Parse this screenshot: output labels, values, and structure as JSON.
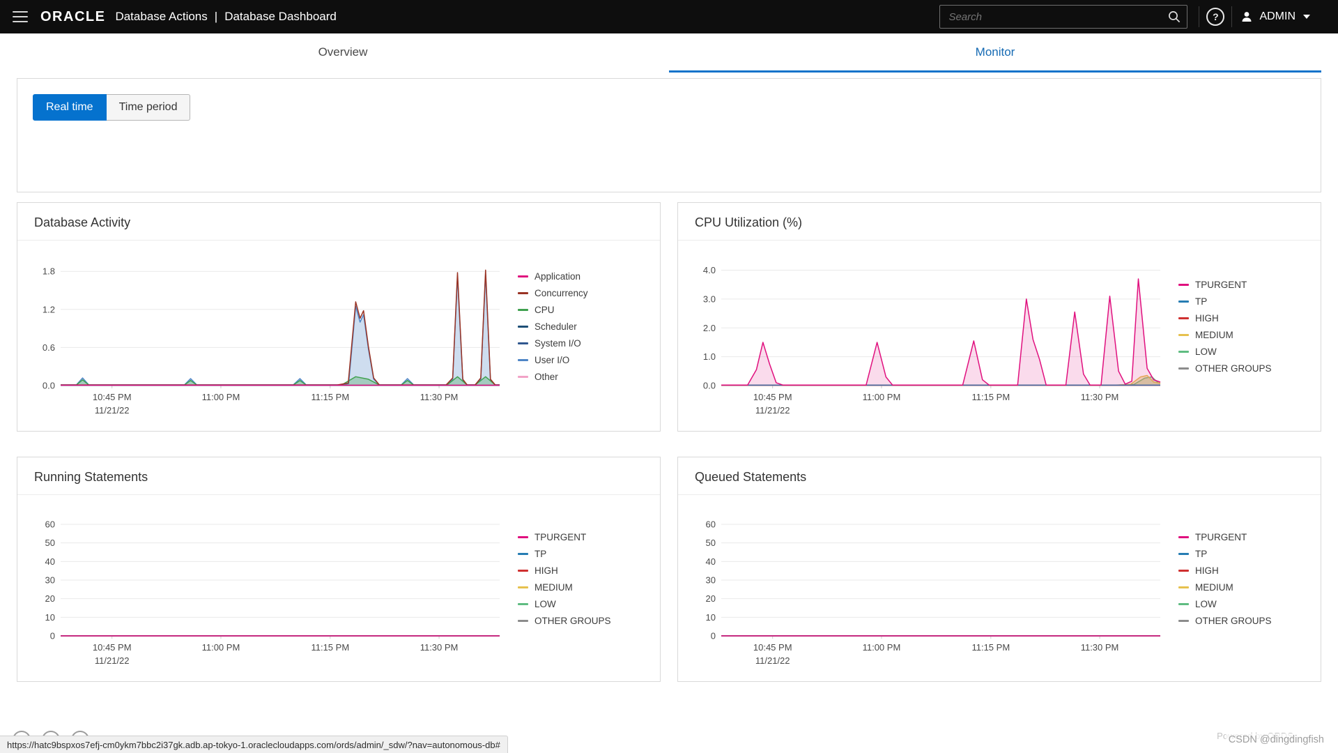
{
  "colors": {
    "accent": "#0572ce",
    "header_bg": "#0e0e0e"
  },
  "header": {
    "brand": "ORACLE",
    "app_title": "Database Actions",
    "divider": "|",
    "page_title": "Database Dashboard",
    "search_placeholder": "Search",
    "user_label": "ADMIN"
  },
  "tabs": {
    "overview": "Overview",
    "monitor": "Monitor"
  },
  "toolbar": {
    "real_time": "Real time",
    "time_period": "Time period"
  },
  "footer": {
    "status_url": "https://hatc9bspxos7efj-cm0ykm7bbc2i37gk.adb.ap-tokyo-1.oraclecloudapps.com/ords/admin/_sdw/?nav=autonomous-db#",
    "watermark": "CSDN @dingdingfish",
    "powered_by": "Powered by ORDS"
  },
  "chart_data": [
    {
      "id": "database-activity",
      "type": "area",
      "title": "Database Activity",
      "ylabel": "",
      "ymax": 2.0,
      "yticks": [
        {
          "v": 0,
          "label": "0.0"
        },
        {
          "v": 0.6,
          "label": "0.6"
        },
        {
          "v": 1.2,
          "label": "1.2"
        },
        {
          "v": 1.8,
          "label": "1.8"
        }
      ],
      "xticks": [
        {
          "pos": 0.117,
          "label": "10:45 PM",
          "sub": "11/21/22"
        },
        {
          "pos": 0.365,
          "label": "11:00 PM"
        },
        {
          "pos": 0.614,
          "label": "11:15 PM"
        },
        {
          "pos": 0.862,
          "label": "11:30 PM"
        }
      ],
      "legend_position": "right",
      "series": [
        {
          "name": "Application",
          "color": "#e0107e",
          "fill": false,
          "fill_opacity": 0,
          "points": [
            [
              0,
              0.005
            ],
            [
              1,
              0.005
            ]
          ]
        },
        {
          "name": "Concurrency",
          "color": "#9a3324",
          "fill": false,
          "fill_opacity": 0,
          "points": [
            [
              0,
              0.01
            ],
            [
              0.63,
              0.01
            ],
            [
              0.655,
              0.04
            ],
            [
              0.672,
              1.32
            ],
            [
              0.682,
              1.06
            ],
            [
              0.69,
              1.18
            ],
            [
              0.701,
              0.62
            ],
            [
              0.713,
              0.12
            ],
            [
              0.726,
              0.01
            ],
            [
              0.878,
              0.01
            ],
            [
              0.893,
              0.12
            ],
            [
              0.904,
              1.78
            ],
            [
              0.916,
              0.1
            ],
            [
              0.926,
              0.01
            ],
            [
              0.944,
              0.01
            ],
            [
              0.957,
              0.12
            ],
            [
              0.968,
              1.82
            ],
            [
              0.979,
              0.1
            ],
            [
              0.99,
              0.01
            ],
            [
              1,
              0.01
            ]
          ]
        },
        {
          "name": "CPU",
          "color": "#3fa14f",
          "fill": true,
          "fill_opacity": 0.3,
          "points": [
            [
              0,
              0.01
            ],
            [
              0.036,
              0.01
            ],
            [
              0.05,
              0.09
            ],
            [
              0.064,
              0.01
            ],
            [
              0.282,
              0.01
            ],
            [
              0.296,
              0.08
            ],
            [
              0.31,
              0.01
            ],
            [
              0.53,
              0.01
            ],
            [
              0.545,
              0.08
            ],
            [
              0.559,
              0.01
            ],
            [
              0.64,
              0.01
            ],
            [
              0.672,
              0.14
            ],
            [
              0.701,
              0.1
            ],
            [
              0.726,
              0.01
            ],
            [
              0.776,
              0.01
            ],
            [
              0.79,
              0.08
            ],
            [
              0.804,
              0.01
            ],
            [
              0.88,
              0.01
            ],
            [
              0.904,
              0.14
            ],
            [
              0.926,
              0.01
            ],
            [
              0.944,
              0.01
            ],
            [
              0.968,
              0.14
            ],
            [
              0.99,
              0.01
            ],
            [
              1,
              0.01
            ]
          ]
        },
        {
          "name": "Scheduler",
          "color": "#1d4f76",
          "fill": false,
          "fill_opacity": 0,
          "points": [
            [
              0,
              0.003
            ],
            [
              1,
              0.003
            ]
          ]
        },
        {
          "name": "System I/O",
          "color": "#30588f",
          "fill": false,
          "fill_opacity": 0,
          "points": [
            [
              0,
              0.004
            ],
            [
              1,
              0.004
            ]
          ]
        },
        {
          "name": "User I/O",
          "color": "#4f86c6",
          "fill": true,
          "fill_opacity": 0.28,
          "points": [
            [
              0,
              0.012
            ],
            [
              0.036,
              0.012
            ],
            [
              0.05,
              0.12
            ],
            [
              0.064,
              0.012
            ],
            [
              0.282,
              0.012
            ],
            [
              0.296,
              0.11
            ],
            [
              0.31,
              0.012
            ],
            [
              0.53,
              0.012
            ],
            [
              0.545,
              0.11
            ],
            [
              0.559,
              0.012
            ],
            [
              0.64,
              0.012
            ],
            [
              0.656,
              0.03
            ],
            [
              0.672,
              1.25
            ],
            [
              0.682,
              1.0
            ],
            [
              0.69,
              1.12
            ],
            [
              0.701,
              0.58
            ],
            [
              0.713,
              0.1
            ],
            [
              0.726,
              0.012
            ],
            [
              0.776,
              0.012
            ],
            [
              0.79,
              0.11
            ],
            [
              0.804,
              0.012
            ],
            [
              0.878,
              0.012
            ],
            [
              0.893,
              0.1
            ],
            [
              0.904,
              1.72
            ],
            [
              0.916,
              0.08
            ],
            [
              0.926,
              0.012
            ],
            [
              0.944,
              0.012
            ],
            [
              0.957,
              0.1
            ],
            [
              0.968,
              1.76
            ],
            [
              0.979,
              0.08
            ],
            [
              0.99,
              0.012
            ],
            [
              1,
              0.012
            ]
          ]
        },
        {
          "name": "Other",
          "color": "#f2a3c7",
          "fill": false,
          "fill_opacity": 0,
          "points": [
            [
              0,
              0.002
            ],
            [
              1,
              0.002
            ]
          ]
        }
      ]
    },
    {
      "id": "cpu-utilization",
      "type": "area",
      "title": "CPU Utilization (%)",
      "ylabel": "",
      "ymax": 4.4,
      "yticks": [
        {
          "v": 0,
          "label": "0.0"
        },
        {
          "v": 1,
          "label": "1.0"
        },
        {
          "v": 2,
          "label": "2.0"
        },
        {
          "v": 3,
          "label": "3.0"
        },
        {
          "v": 4,
          "label": "4.0"
        }
      ],
      "xticks": [
        {
          "pos": 0.117,
          "label": "10:45 PM",
          "sub": "11/21/22"
        },
        {
          "pos": 0.365,
          "label": "11:00 PM"
        },
        {
          "pos": 0.614,
          "label": "11:15 PM"
        },
        {
          "pos": 0.862,
          "label": "11:30 PM"
        }
      ],
      "legend_position": "right",
      "series": [
        {
          "name": "TPURGENT",
          "color": "#e0107e",
          "fill": true,
          "fill_opacity": 0.15,
          "points": [
            [
              0,
              0.02
            ],
            [
              0.06,
              0.02
            ],
            [
              0.08,
              0.55
            ],
            [
              0.095,
              1.5
            ],
            [
              0.11,
              0.75
            ],
            [
              0.125,
              0.1
            ],
            [
              0.14,
              0.02
            ],
            [
              0.33,
              0.02
            ],
            [
              0.355,
              1.5
            ],
            [
              0.375,
              0.3
            ],
            [
              0.39,
              0.02
            ],
            [
              0.55,
              0.02
            ],
            [
              0.575,
              1.55
            ],
            [
              0.595,
              0.2
            ],
            [
              0.61,
              0.02
            ],
            [
              0.675,
              0.02
            ],
            [
              0.695,
              3.0
            ],
            [
              0.71,
              1.6
            ],
            [
              0.725,
              0.9
            ],
            [
              0.74,
              0.02
            ],
            [
              0.785,
              0.02
            ],
            [
              0.805,
              2.55
            ],
            [
              0.825,
              0.4
            ],
            [
              0.84,
              0.02
            ],
            [
              0.865,
              0.02
            ],
            [
              0.885,
              3.1
            ],
            [
              0.905,
              0.5
            ],
            [
              0.92,
              0.05
            ],
            [
              0.935,
              0.15
            ],
            [
              0.95,
              3.7
            ],
            [
              0.97,
              0.6
            ],
            [
              0.985,
              0.2
            ],
            [
              1,
              0.12
            ]
          ]
        },
        {
          "name": "TP",
          "color": "#267db3",
          "fill": false,
          "fill_opacity": 0,
          "points": [
            [
              0,
              0.015
            ],
            [
              1,
              0.015
            ]
          ]
        },
        {
          "name": "HIGH",
          "color": "#cf3030",
          "fill": false,
          "fill_opacity": 0,
          "points": [
            [
              0,
              0.01
            ],
            [
              1,
              0.01
            ]
          ]
        },
        {
          "name": "MEDIUM",
          "color": "#e6c14e",
          "fill": true,
          "fill_opacity": 0.35,
          "points": [
            [
              0,
              0.02
            ],
            [
              0.9,
              0.02
            ],
            [
              0.932,
              0.04
            ],
            [
              0.955,
              0.3
            ],
            [
              0.97,
              0.35
            ],
            [
              0.985,
              0.12
            ],
            [
              1,
              0.08
            ]
          ]
        },
        {
          "name": "LOW",
          "color": "#5fbc81",
          "fill": true,
          "fill_opacity": 0.3,
          "points": [
            [
              0,
              0.015
            ],
            [
              0.9,
              0.015
            ],
            [
              0.94,
              0.04
            ],
            [
              0.965,
              0.26
            ],
            [
              0.981,
              0.3
            ],
            [
              0.995,
              0.1
            ],
            [
              1,
              0.08
            ]
          ]
        },
        {
          "name": "OTHER GROUPS",
          "color": "#8c8c8c",
          "fill": false,
          "fill_opacity": 0,
          "points": [
            [
              0,
              0.005
            ],
            [
              1,
              0.005
            ]
          ]
        }
      ]
    },
    {
      "id": "running-statements",
      "type": "line",
      "title": "Running Statements",
      "ylabel": "",
      "ymax": 66,
      "yticks": [
        {
          "v": 0,
          "label": "0"
        },
        {
          "v": 10,
          "label": "10"
        },
        {
          "v": 20,
          "label": "20"
        },
        {
          "v": 30,
          "label": "30"
        },
        {
          "v": 40,
          "label": "40"
        },
        {
          "v": 50,
          "label": "50"
        },
        {
          "v": 60,
          "label": "60"
        }
      ],
      "xticks": [
        {
          "pos": 0.117,
          "label": "10:45 PM",
          "sub": "11/21/22"
        },
        {
          "pos": 0.365,
          "label": "11:00 PM"
        },
        {
          "pos": 0.614,
          "label": "11:15 PM"
        },
        {
          "pos": 0.862,
          "label": "11:30 PM"
        }
      ],
      "legend_position": "right",
      "series": [
        {
          "name": "TPURGENT",
          "color": "#e0107e",
          "fill": false,
          "fill_opacity": 0,
          "points": [
            [
              0,
              0
            ],
            [
              1,
              0
            ]
          ]
        },
        {
          "name": "TP",
          "color": "#267db3",
          "fill": false,
          "fill_opacity": 0,
          "points": [
            [
              0,
              0
            ],
            [
              1,
              0
            ]
          ]
        },
        {
          "name": "HIGH",
          "color": "#cf3030",
          "fill": false,
          "fill_opacity": 0,
          "points": [
            [
              0,
              0
            ],
            [
              1,
              0
            ]
          ]
        },
        {
          "name": "MEDIUM",
          "color": "#e6c14e",
          "fill": false,
          "fill_opacity": 0,
          "points": [
            [
              0,
              0
            ],
            [
              1,
              0
            ]
          ]
        },
        {
          "name": "LOW",
          "color": "#5fbc81",
          "fill": false,
          "fill_opacity": 0,
          "points": [
            [
              0,
              0
            ],
            [
              1,
              0
            ]
          ]
        },
        {
          "name": "OTHER GROUPS",
          "color": "#8c8c8c",
          "fill": false,
          "fill_opacity": 0,
          "points": [
            [
              0,
              0
            ],
            [
              1,
              0
            ]
          ]
        }
      ]
    },
    {
      "id": "queued-statements",
      "type": "line",
      "title": "Queued Statements",
      "ylabel": "",
      "ymax": 66,
      "yticks": [
        {
          "v": 0,
          "label": "0"
        },
        {
          "v": 10,
          "label": "10"
        },
        {
          "v": 20,
          "label": "20"
        },
        {
          "v": 30,
          "label": "30"
        },
        {
          "v": 40,
          "label": "40"
        },
        {
          "v": 50,
          "label": "50"
        },
        {
          "v": 60,
          "label": "60"
        }
      ],
      "xticks": [
        {
          "pos": 0.117,
          "label": "10:45 PM",
          "sub": "11/21/22"
        },
        {
          "pos": 0.365,
          "label": "11:00 PM"
        },
        {
          "pos": 0.614,
          "label": "11:15 PM"
        },
        {
          "pos": 0.862,
          "label": "11:30 PM"
        }
      ],
      "legend_position": "right",
      "series": [
        {
          "name": "TPURGENT",
          "color": "#e0107e",
          "fill": false,
          "fill_opacity": 0,
          "points": [
            [
              0,
              0
            ],
            [
              1,
              0
            ]
          ]
        },
        {
          "name": "TP",
          "color": "#267db3",
          "fill": false,
          "fill_opacity": 0,
          "points": [
            [
              0,
              0
            ],
            [
              1,
              0
            ]
          ]
        },
        {
          "name": "HIGH",
          "color": "#cf3030",
          "fill": false,
          "fill_opacity": 0,
          "points": [
            [
              0,
              0
            ],
            [
              1,
              0
            ]
          ]
        },
        {
          "name": "MEDIUM",
          "color": "#e6c14e",
          "fill": false,
          "fill_opacity": 0,
          "points": [
            [
              0,
              0
            ],
            [
              1,
              0
            ]
          ]
        },
        {
          "name": "LOW",
          "color": "#5fbc81",
          "fill": false,
          "fill_opacity": 0,
          "points": [
            [
              0,
              0
            ],
            [
              1,
              0
            ]
          ]
        },
        {
          "name": "OTHER GROUPS",
          "color": "#8c8c8c",
          "fill": false,
          "fill_opacity": 0,
          "points": [
            [
              0,
              0
            ],
            [
              1,
              0
            ]
          ]
        }
      ]
    }
  ]
}
